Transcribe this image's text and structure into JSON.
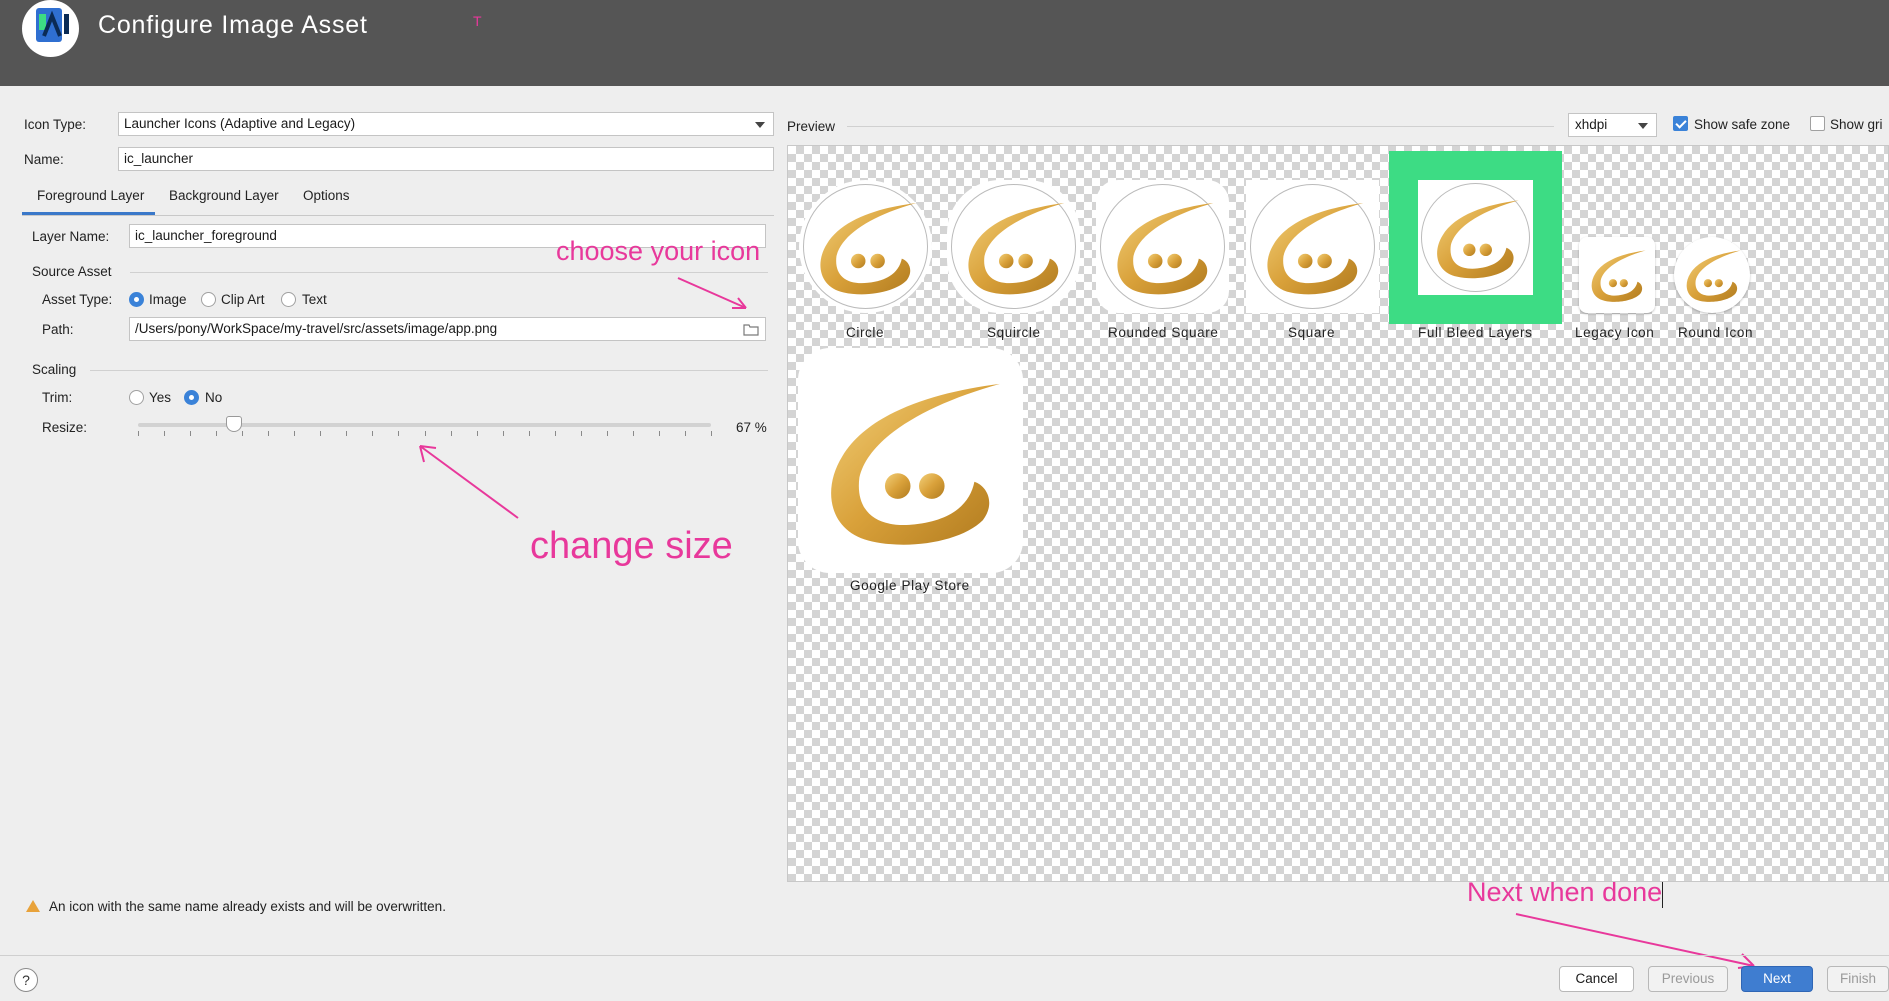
{
  "window": {
    "title": "Configure Image Asset",
    "cursor_mark": "T"
  },
  "form": {
    "icon_type": {
      "label": "Icon Type:",
      "value": "Launcher Icons (Adaptive and Legacy)"
    },
    "name": {
      "label": "Name:",
      "value": "ic_launcher"
    },
    "tabs": [
      {
        "label": "Foreground Layer",
        "selected": true
      },
      {
        "label": "Background Layer",
        "selected": false
      },
      {
        "label": "Options",
        "selected": false
      }
    ],
    "layer_name": {
      "label": "Layer Name:",
      "value": "ic_launcher_foreground"
    },
    "source_asset": {
      "section_title": "Source Asset",
      "asset_type_label": "Asset Type:",
      "options": [
        "Image",
        "Clip Art",
        "Text"
      ],
      "selected": "Image",
      "path_label": "Path:",
      "path_value": "/Users/pony/WorkSpace/my-travel/src/assets/image/app.png"
    },
    "scaling": {
      "section_title": "Scaling",
      "trim_label": "Trim:",
      "trim_options": [
        "Yes",
        "No"
      ],
      "trim_selected": "No",
      "resize_label": "Resize:",
      "resize_value": "67 %",
      "resize_fraction": 0.167
    }
  },
  "annotations": {
    "choose_icon": "choose your icon",
    "change_size": "change size",
    "next_when_done": "Next when done",
    "color": "#e8389b"
  },
  "preview": {
    "title": "Preview",
    "density": "xhdpi",
    "show_safe_zone": {
      "label": "Show safe zone",
      "checked": true
    },
    "show_grid": {
      "label": "Show gri",
      "checked": false
    },
    "icons": [
      {
        "label": "Circle"
      },
      {
        "label": "Squircle"
      },
      {
        "label": "Rounded Square"
      },
      {
        "label": "Square"
      },
      {
        "label": "Full Bleed Layers"
      },
      {
        "label": "Legacy Icon"
      },
      {
        "label": "Round Icon"
      },
      {
        "label": "Google Play Store"
      }
    ],
    "full_bleed_color": "#3ddc84"
  },
  "warning": {
    "text": "An icon with the same name already exists and will be overwritten."
  },
  "buttons": {
    "help": "?",
    "cancel": "Cancel",
    "previous": "Previous",
    "next": "Next",
    "finish": "Finish"
  },
  "colors": {
    "accent": "#3a82d8",
    "header_bg": "#555555",
    "icon_gold": "#d9a13a"
  }
}
